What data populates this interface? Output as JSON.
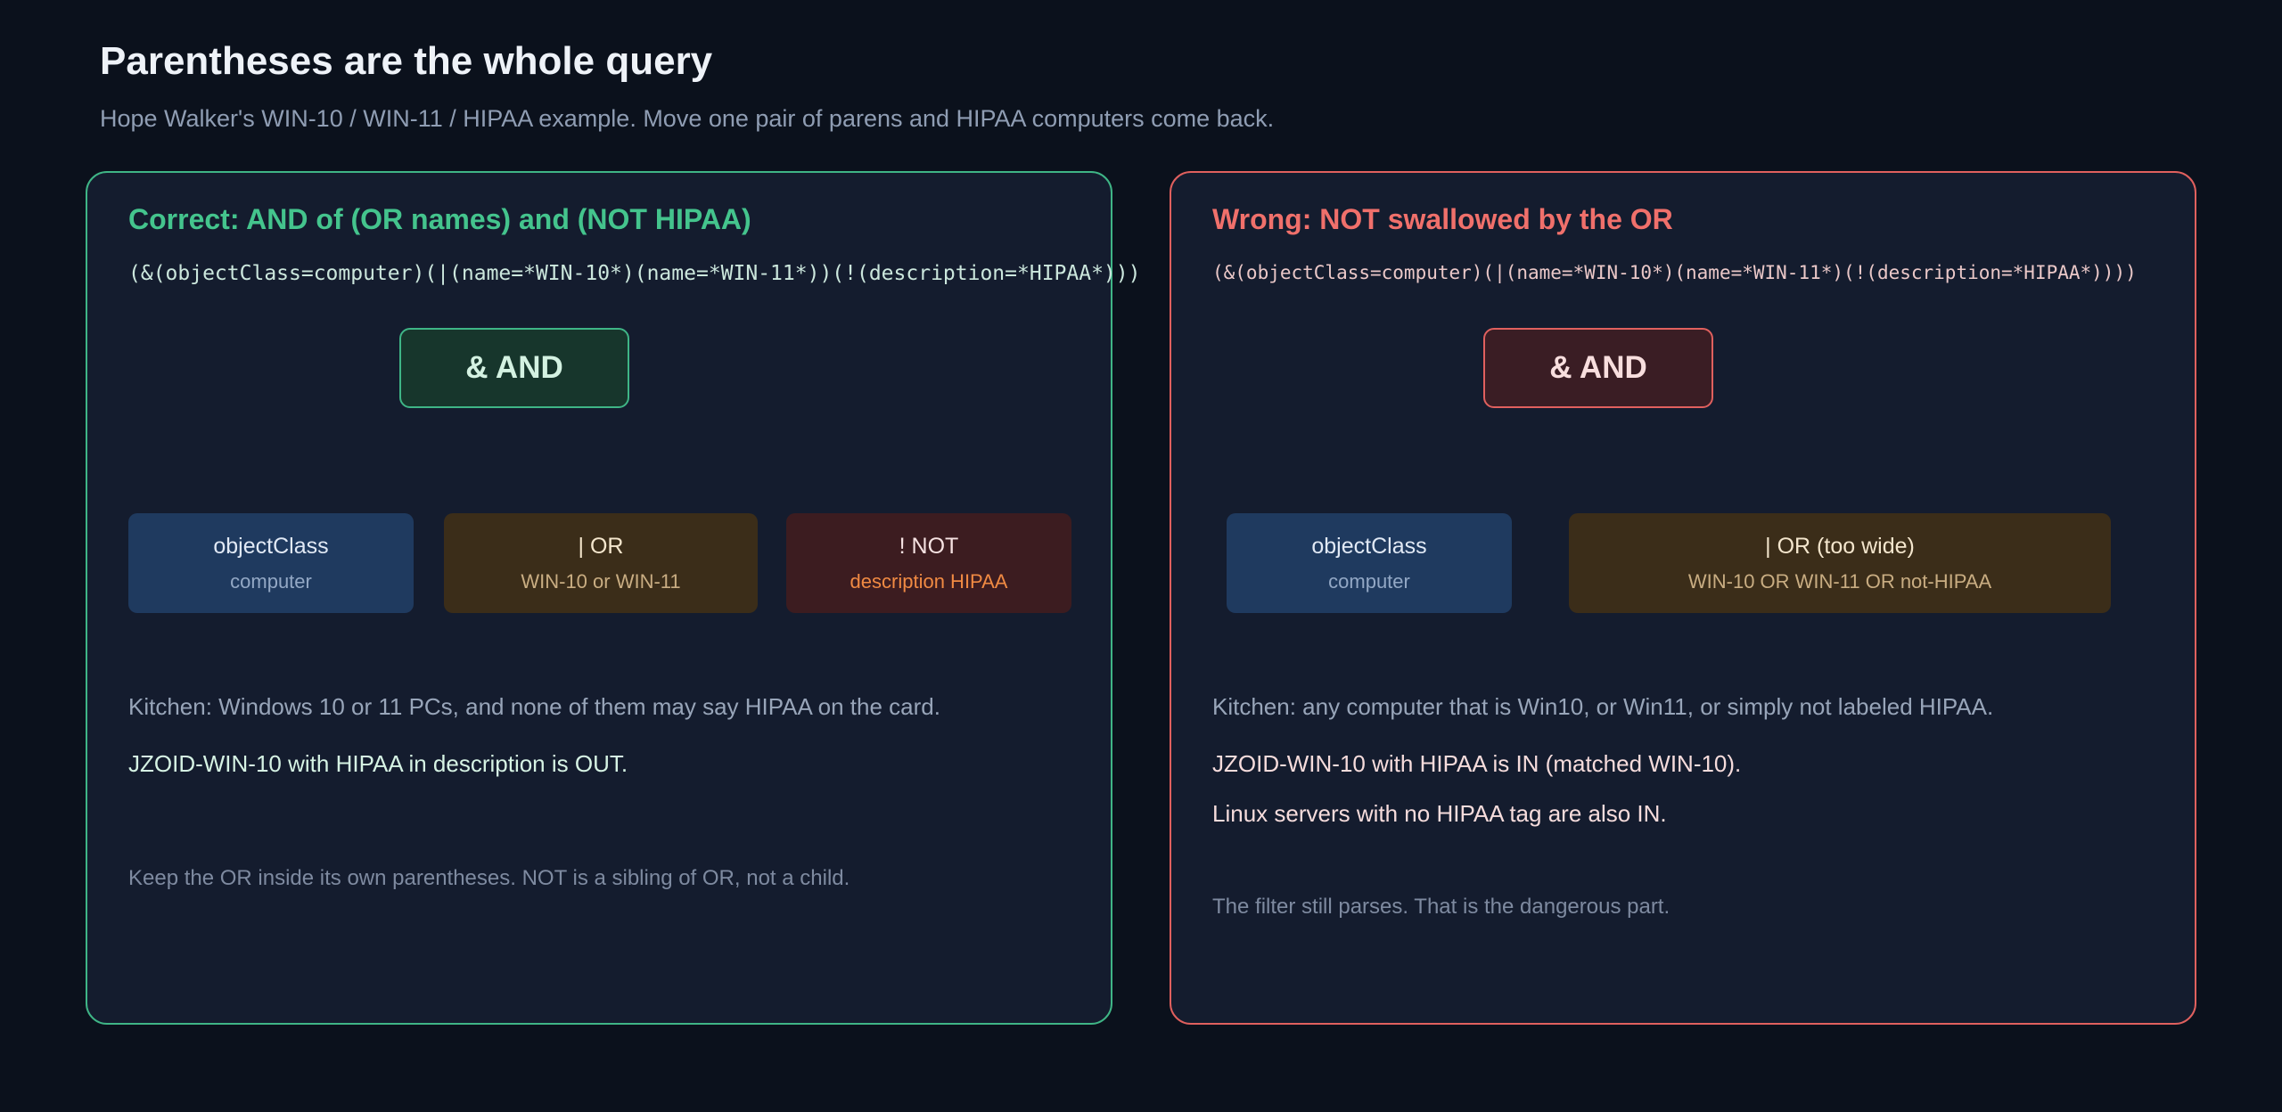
{
  "header": {
    "title": "Parentheses are the whole query",
    "subtitle": "Hope Walker's WIN-10 / WIN-11 / HIPAA example. Move one pair of parens and HIPAA computers come back."
  },
  "left_panel": {
    "heading": "Correct: AND of (OR names) and (NOT HIPAA)",
    "query": "(&(objectClass=computer)(|(name=*WIN-10*)(name=*WIN-11*))(!(description=*HIPAA*)))",
    "and_node": "& AND",
    "nodes": [
      {
        "label": "objectClass",
        "sub": "computer"
      },
      {
        "label": "| OR",
        "sub": "WIN-10 or WIN-11"
      },
      {
        "label": "! NOT",
        "sub": "description HIPAA"
      }
    ],
    "kitchen": "Kitchen: Windows 10 or 11 PCs, and none of them may say HIPAA on the card.",
    "result_1": "JZOID-WIN-10 with HIPAA in description is OUT.",
    "footnote": "Keep the OR inside its own parentheses. NOT is a sibling of OR, not a child."
  },
  "right_panel": {
    "heading": "Wrong: NOT swallowed by the OR",
    "query": "(&(objectClass=computer)(|(name=*WIN-10*)(name=*WIN-11*)(!(description=*HIPAA*))))",
    "and_node": "& AND",
    "nodes": [
      {
        "label": "objectClass",
        "sub": "computer"
      },
      {
        "label": "| OR (too wide)",
        "sub": "WIN-10 OR WIN-11 OR not-HIPAA"
      }
    ],
    "kitchen": "Kitchen: any computer that is Win10, or Win11, or simply not labeled HIPAA.",
    "result_1": "JZOID-WIN-10 with HIPAA is IN (matched WIN-10).",
    "result_2": "Linux servers with no HIPAA tag are also IN.",
    "footnote": "The filter still parses. That is the dangerous part."
  }
}
